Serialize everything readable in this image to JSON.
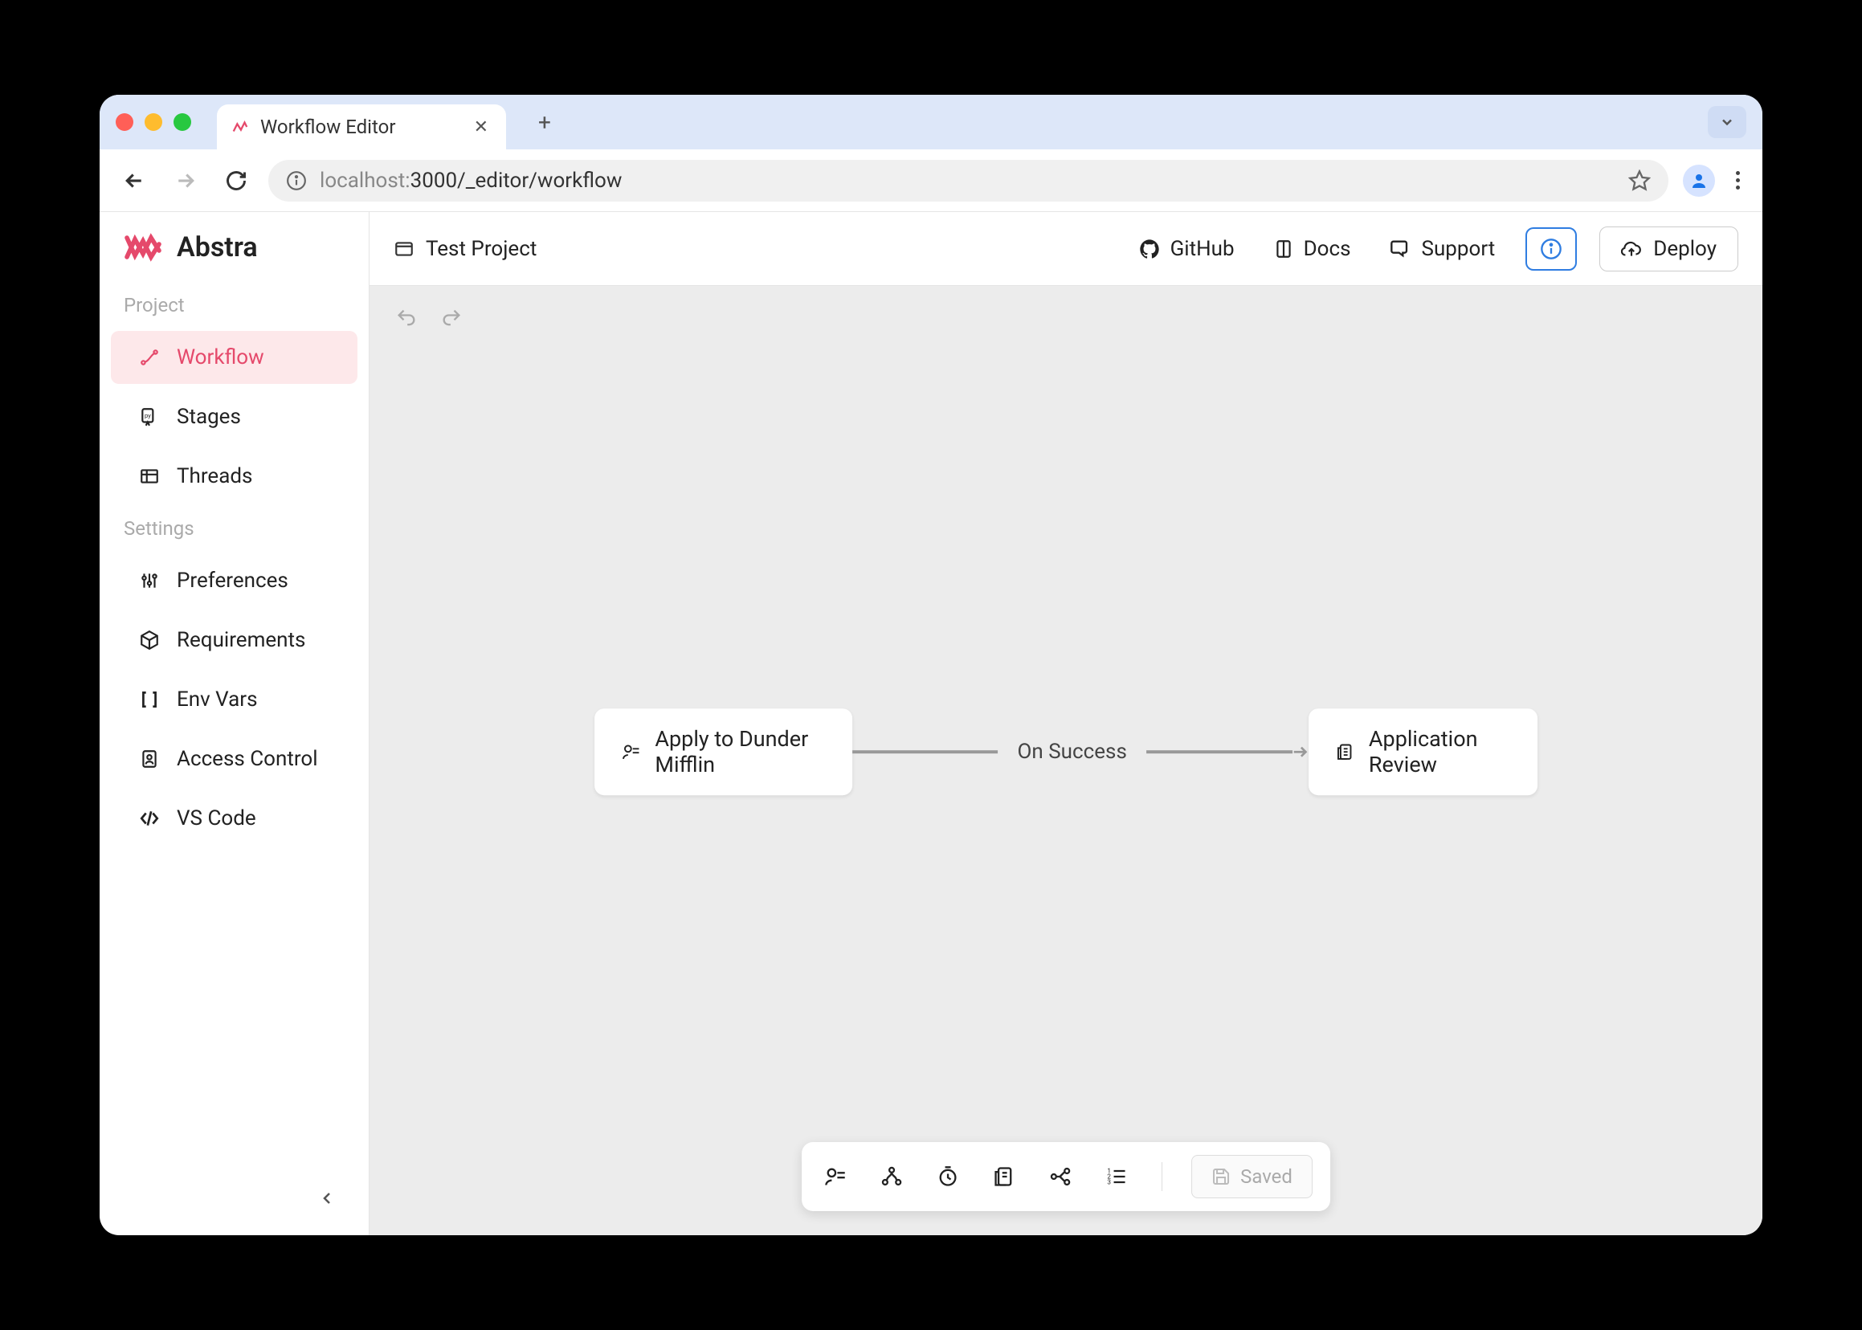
{
  "browser": {
    "tab_title": "Workflow Editor",
    "url_host": "localhost:",
    "url_port_path": "3000/_editor/workflow"
  },
  "app": {
    "brand": "Abstra"
  },
  "sidebar": {
    "section_project": "Project",
    "section_settings": "Settings",
    "items": {
      "workflow": "Workflow",
      "stages": "Stages",
      "threads": "Threads",
      "preferences": "Preferences",
      "requirements": "Requirements",
      "envvars": "Env Vars",
      "access": "Access Control",
      "vscode": "VS Code"
    }
  },
  "topbar": {
    "project_name": "Test Project",
    "github": "GitHub",
    "docs": "Docs",
    "support": "Support",
    "deploy": "Deploy"
  },
  "workflow": {
    "node1": "Apply to Dunder Mifflin",
    "edge_label": "On Success",
    "node2": "Application Review"
  },
  "bottom": {
    "saved": "Saved"
  }
}
